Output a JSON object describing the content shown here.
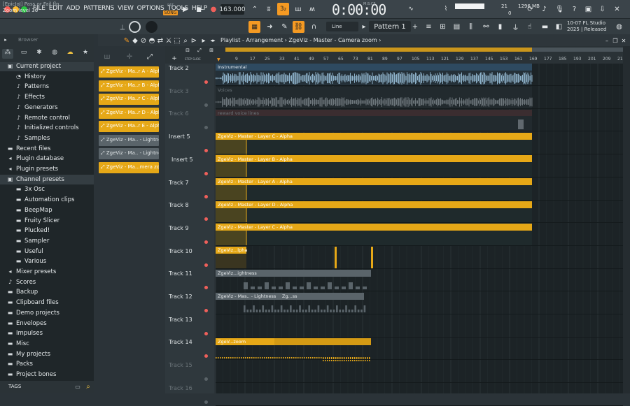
{
  "menu": [
    "FILE",
    "EDIT",
    "ADD",
    "PATTERNS",
    "VIEW",
    "OPTIONS",
    "TOOLS",
    "HELP"
  ],
  "transport": {
    "pat_label": "PAT",
    "song_label": "SONG",
    "tempo": "163.000",
    "time": "0:00:00",
    "time_unit": "M:S:CS"
  },
  "monitor": {
    "cpu": "21",
    "memory": "1296 MB",
    "polyphony": "0"
  },
  "project": {
    "file": "[EpicJoJ] Pass or Fail.flp",
    "hint": "Zoom level 36"
  },
  "toolbar": {
    "snap": "Line",
    "pattern": "Pattern 1"
  },
  "flinfo": {
    "line1": "10-07  FL Studio",
    "line2": "2025 | Released"
  },
  "browser": {
    "title": "Browser",
    "items": [
      {
        "label": "Current project",
        "icon": "folder-open-icon",
        "indent": 0
      },
      {
        "label": "History",
        "icon": "history-icon",
        "indent": 1
      },
      {
        "label": "Patterns",
        "icon": "patterns-icon",
        "indent": 1
      },
      {
        "label": "Effects",
        "icon": "effects-icon",
        "indent": 1
      },
      {
        "label": "Generators",
        "icon": "generators-icon",
        "indent": 1
      },
      {
        "label": "Remote control",
        "icon": "remote-icon",
        "indent": 1
      },
      {
        "label": "Initialized controls",
        "icon": "controls-icon",
        "indent": 1
      },
      {
        "label": "Samples",
        "icon": "samples-icon",
        "indent": 1
      },
      {
        "label": "Recent files",
        "icon": "folder-icon",
        "indent": 0
      },
      {
        "label": "Plugin database",
        "icon": "plugin-icon",
        "indent": 0
      },
      {
        "label": "Plugin presets",
        "icon": "plugin-icon",
        "indent": 0
      },
      {
        "label": "Channel presets",
        "icon": "folder-open-icon",
        "indent": 0
      },
      {
        "label": "3x Osc",
        "icon": "folder-icon",
        "indent": 1
      },
      {
        "label": "Automation clips",
        "icon": "folder-icon",
        "indent": 1
      },
      {
        "label": "BeepMap",
        "icon": "folder-icon",
        "indent": 1
      },
      {
        "label": "Fruity Slicer",
        "icon": "folder-icon",
        "indent": 1
      },
      {
        "label": "Plucked!",
        "icon": "folder-icon",
        "indent": 1
      },
      {
        "label": "Sampler",
        "icon": "folder-icon",
        "indent": 1
      },
      {
        "label": "Useful",
        "icon": "folder-icon",
        "indent": 1
      },
      {
        "label": "Various",
        "icon": "folder-icon",
        "indent": 1
      },
      {
        "label": "Mixer presets",
        "icon": "mixer-icon",
        "indent": 0
      },
      {
        "label": "Scores",
        "icon": "note-icon",
        "indent": 0
      },
      {
        "label": "Backup",
        "icon": "folder-icon",
        "indent": 0
      },
      {
        "label": "Clipboard files",
        "icon": "folder-icon",
        "indent": 0
      },
      {
        "label": "Demo projects",
        "icon": "folder-icon",
        "indent": 0
      },
      {
        "label": "Envelopes",
        "icon": "folder-icon",
        "indent": 0
      },
      {
        "label": "Impulses",
        "icon": "folder-icon",
        "indent": 0
      },
      {
        "label": "Misc",
        "icon": "folder-icon",
        "indent": 0
      },
      {
        "label": "My projects",
        "icon": "folder-icon",
        "indent": 0
      },
      {
        "label": "Packs",
        "icon": "folder-icon",
        "indent": 0
      },
      {
        "label": "Project bones",
        "icon": "folder-icon",
        "indent": 0
      }
    ],
    "tags_label": "TAGS"
  },
  "cliplist": [
    {
      "label": "ZgeViz - Ma..r A - Alpha",
      "kind": "automation"
    },
    {
      "label": "ZgeViz - Ma..r B - Alpha",
      "kind": "automation"
    },
    {
      "label": "ZgeViz - Ma..r C - Alpha",
      "kind": "automation"
    },
    {
      "label": "ZgeViz - Ma..r D - Alpha",
      "kind": "automation"
    },
    {
      "label": "ZgeViz - Ma..r E - Alpha",
      "kind": "automation"
    },
    {
      "label": "ZgeViz - Ma.. - Lightness",
      "kind": "inactive"
    },
    {
      "label": "ZgeViz - Ma.. - Lightness",
      "kind": "inactive"
    },
    {
      "label": "ZgeViz - Ma...mera zoom",
      "kind": "automation"
    }
  ],
  "playlist": {
    "breadcrumb": "Playlist - Arrangement › ZgeViz - Master - Camera zoom ›",
    "ruler": [
      "9",
      "17",
      "25",
      "33",
      "41",
      "49",
      "57",
      "65",
      "73",
      "81",
      "89",
      "97",
      "105",
      "113",
      "121",
      "129",
      "137",
      "145",
      "153",
      "161",
      "169",
      "177",
      "185",
      "193",
      "201",
      "209",
      "21"
    ],
    "tracks": [
      {
        "name": "Track 2",
        "muted": false
      },
      {
        "name": "Track 3",
        "muted": true
      },
      {
        "name": "Track 6",
        "muted": true
      },
      {
        "name": "Insert 5",
        "muted": false
      },
      {
        "name": "Insert 5",
        "muted": false
      },
      {
        "name": "Track 7",
        "muted": false
      },
      {
        "name": "Track 8",
        "muted": false
      },
      {
        "name": "Track 9",
        "muted": false
      },
      {
        "name": "Track 10",
        "muted": false
      },
      {
        "name": "Track 11",
        "muted": false
      },
      {
        "name": "Track 12",
        "muted": false
      },
      {
        "name": "Track 13",
        "muted": false
      },
      {
        "name": "Track 14",
        "muted": false
      },
      {
        "name": "Track 15",
        "muted": true
      },
      {
        "name": "Track 16",
        "muted": true
      }
    ],
    "clips": {
      "instrumental": "Instrumental",
      "voices": "Voices",
      "reversed": "reward voice lines",
      "layerC": "ZgeViz - Master - Layer C - Alpha",
      "layerB": "ZgeViz - Master - Layer B - Alpha",
      "layerA": "ZgeViz - Master - Layer A - Alpha",
      "layerD": "ZgeViz - Master - Layer D - Alpha",
      "layerC2": "ZgeViz - Master - Layer C - Alpha",
      "t10": "ZgeViz...lpha",
      "t11": "ZgeViz...ightness",
      "t12": "ZgeViz - Mas.. - Lightness",
      "t12b": "Zg...ss",
      "t14": "ZgeV...zoom"
    }
  },
  "colors": {
    "accent": "#f59a23",
    "clip": "#e6a817",
    "audio": "#8fb4cc"
  }
}
